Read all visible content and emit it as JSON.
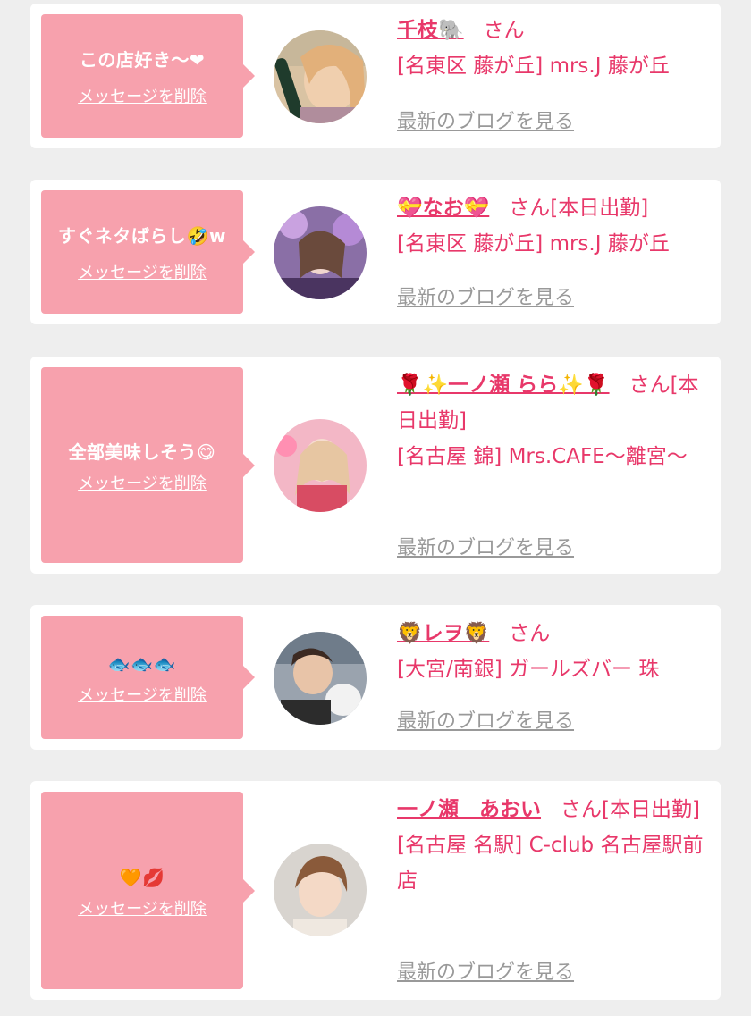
{
  "delete_label": "メッセージを削除",
  "blog_label": "最新のブログを見る",
  "san_suffix": "さん",
  "cards": [
    {
      "message": "この店好き〜❤",
      "name": "千枝🐘",
      "status": "",
      "shop": "[名東区 藤が丘] mrs.J 藤が丘"
    },
    {
      "message": "すぐネタばらし🤣w",
      "name": "💝なお💝",
      "status": "[本日出勤]",
      "shop": "[名東区 藤が丘] mrs.J 藤が丘"
    },
    {
      "message": "全部美味しそう😋",
      "name": "🌹✨一ノ瀬 らら✨🌹",
      "status": "[本日出勤]",
      "shop": "[名古屋 錦] Mrs.CAFE〜離宮〜"
    },
    {
      "message": "🐟🐟🐟",
      "name": "🦁レヲ🦁",
      "status": "",
      "shop": "[大宮/南銀] ガールズバー 珠"
    },
    {
      "message": "🧡💋",
      "name": "一ノ瀬　あおい",
      "status": "[本日出勤]",
      "shop": "[名古屋 名駅] C-club 名古屋駅前店"
    }
  ],
  "colors": {
    "bubble": "#f7a1ad",
    "accent": "#e8386a",
    "muted": "#999999",
    "background": "#eeeeee"
  }
}
